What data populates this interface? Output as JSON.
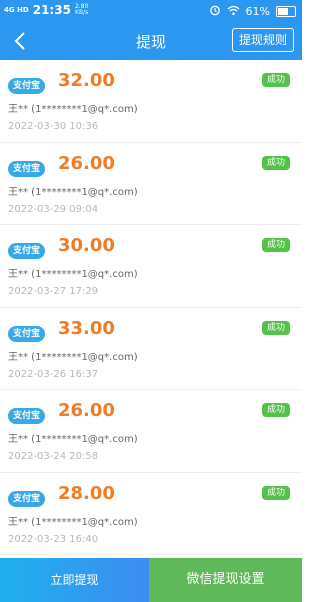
{
  "statusbar": {
    "signal": "4G HD",
    "time": "21:35",
    "speed_value": "2.80",
    "speed_unit": "KB/s",
    "battery": "61%",
    "battery_level": 0.61
  },
  "nav": {
    "title": "提现",
    "rules_label": "提现规则"
  },
  "records": [
    {
      "method": "支付宝",
      "amount": "32.00",
      "status": "成功",
      "account": "王** (1********1@q*.com)",
      "time": "2022-03-30 10:36"
    },
    {
      "method": "支付宝",
      "amount": "26.00",
      "status": "成功",
      "account": "王** (1********1@q*.com)",
      "time": "2022-03-29 09:04"
    },
    {
      "method": "支付宝",
      "amount": "30.00",
      "status": "成功",
      "account": "王** (1********1@q*.com)",
      "time": "2022-03-27 17:29"
    },
    {
      "method": "支付宝",
      "amount": "33.00",
      "status": "成功",
      "account": "王** (1********1@q*.com)",
      "time": "2022-03-26 16:37"
    },
    {
      "method": "支付宝",
      "amount": "26.00",
      "status": "成功",
      "account": "王** (1********1@q*.com)",
      "time": "2022-03-24 20:58"
    },
    {
      "method": "支付宝",
      "amount": "28.00",
      "status": "成功",
      "account": "王** (1********1@q*.com)",
      "time": "2022-03-23 16:40"
    }
  ],
  "bottom": {
    "left_label": "立即提现",
    "right_label": "微信提现设置"
  },
  "colors": {
    "primary": "#2c97f0",
    "amount": "#ef7d26",
    "success": "#55c04a",
    "badge": "#38a9e6",
    "wechat": "#5fb95a"
  }
}
